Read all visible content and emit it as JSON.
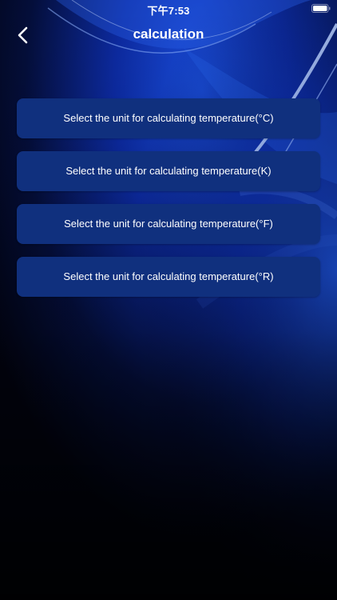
{
  "status_bar": {
    "time": "下午7:53"
  },
  "nav": {
    "title": "calculation",
    "back_icon": "chevron-left-icon"
  },
  "options": [
    {
      "label": "Select the unit for calculating temperature(°C)"
    },
    {
      "label": "Select the unit for calculating temperature(K)"
    },
    {
      "label": "Select the unit for calculating temperature(°F)"
    },
    {
      "label": "Select the unit for calculating temperature(°R)"
    }
  ],
  "colors": {
    "button_bg": "#10307e",
    "background_dark": "#01030f",
    "background_blue": "#0a2fb8"
  }
}
